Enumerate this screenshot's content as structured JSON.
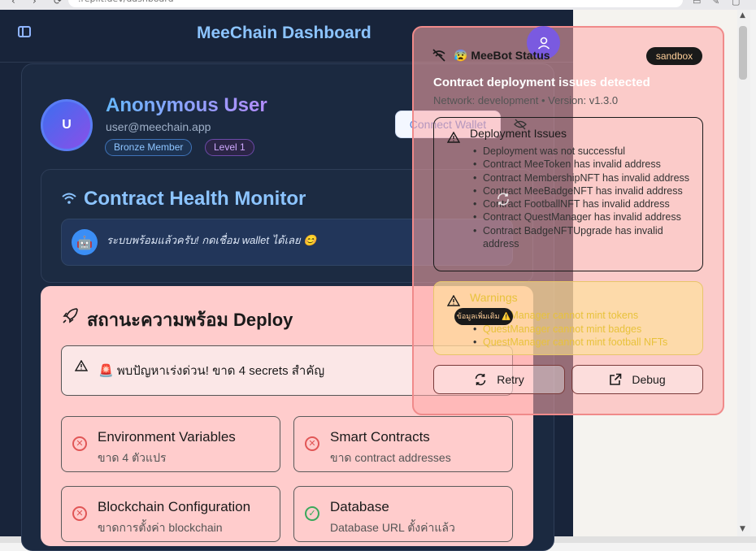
{
  "browser": {
    "url": ".replit.dev/dashboard",
    "nav_back": "‹",
    "nav_forward": "›",
    "nav_reload": "⟳"
  },
  "header": {
    "title": "MeeChain Dashboard"
  },
  "profile": {
    "avatar_initial": "U",
    "name": "Anonymous User",
    "email": "user@meechain.app",
    "member_badge": "Bronze Member",
    "level_badge": "Level 1",
    "connect_label": "Connect Wallet"
  },
  "health": {
    "title": "Contract Health Monitor",
    "bot_emoji": "🤖",
    "bot_message": "ระบบพร้อมแล้วครับ! กดเชื่อม wallet ได้เลย 😊"
  },
  "deploy": {
    "title": "สถานะความพร้อม Deploy",
    "alert": "🚨 พบปัญหาเร่งด่วน! ขาด 4 secrets สำคัญ",
    "checks": [
      {
        "title": "Environment Variables",
        "sub": "ขาด 4 ตัวแปร",
        "status": "error"
      },
      {
        "title": "Smart Contracts",
        "sub": "ขาด contract addresses",
        "status": "error"
      },
      {
        "title": "Blockchain Configuration",
        "sub": "ขาดการตั้งค่า blockchain",
        "status": "error"
      },
      {
        "title": "Database",
        "sub": "Database URL ตั้งค่าแล้ว",
        "status": "ok"
      }
    ]
  },
  "status_panel": {
    "title": "😰 MeeBot Status",
    "sandbox": "sandbox",
    "heading": "Contract deployment issues detected",
    "network": "Network: development • Version: v1.3.0",
    "issues_title": "Deployment Issues",
    "issues": [
      "Deployment was not successful",
      "Contract MeeToken has invalid address",
      "Contract MembershipNFT has invalid address",
      "Contract MeeBadgeNFT has invalid address",
      "Contract FootballNFT has invalid address",
      "Contract QuestManager has invalid address",
      "Contract BadgeNFTUpgrade has invalid address"
    ],
    "warnings_title": "Warnings",
    "warnings": [
      "QuestManager cannot mint tokens",
      "QuestManager cannot mint badges",
      "QuestManager cannot mint football NFTs"
    ],
    "tooltip": "ข้อมูลเพิ่มเติม ⚠️",
    "retry_label": "Retry",
    "debug_label": "Debug"
  },
  "colors": {
    "accent": "#8cc4ff",
    "error": "#e15656",
    "ok": "#3aa85b",
    "panel_border": "#f08a8a"
  }
}
